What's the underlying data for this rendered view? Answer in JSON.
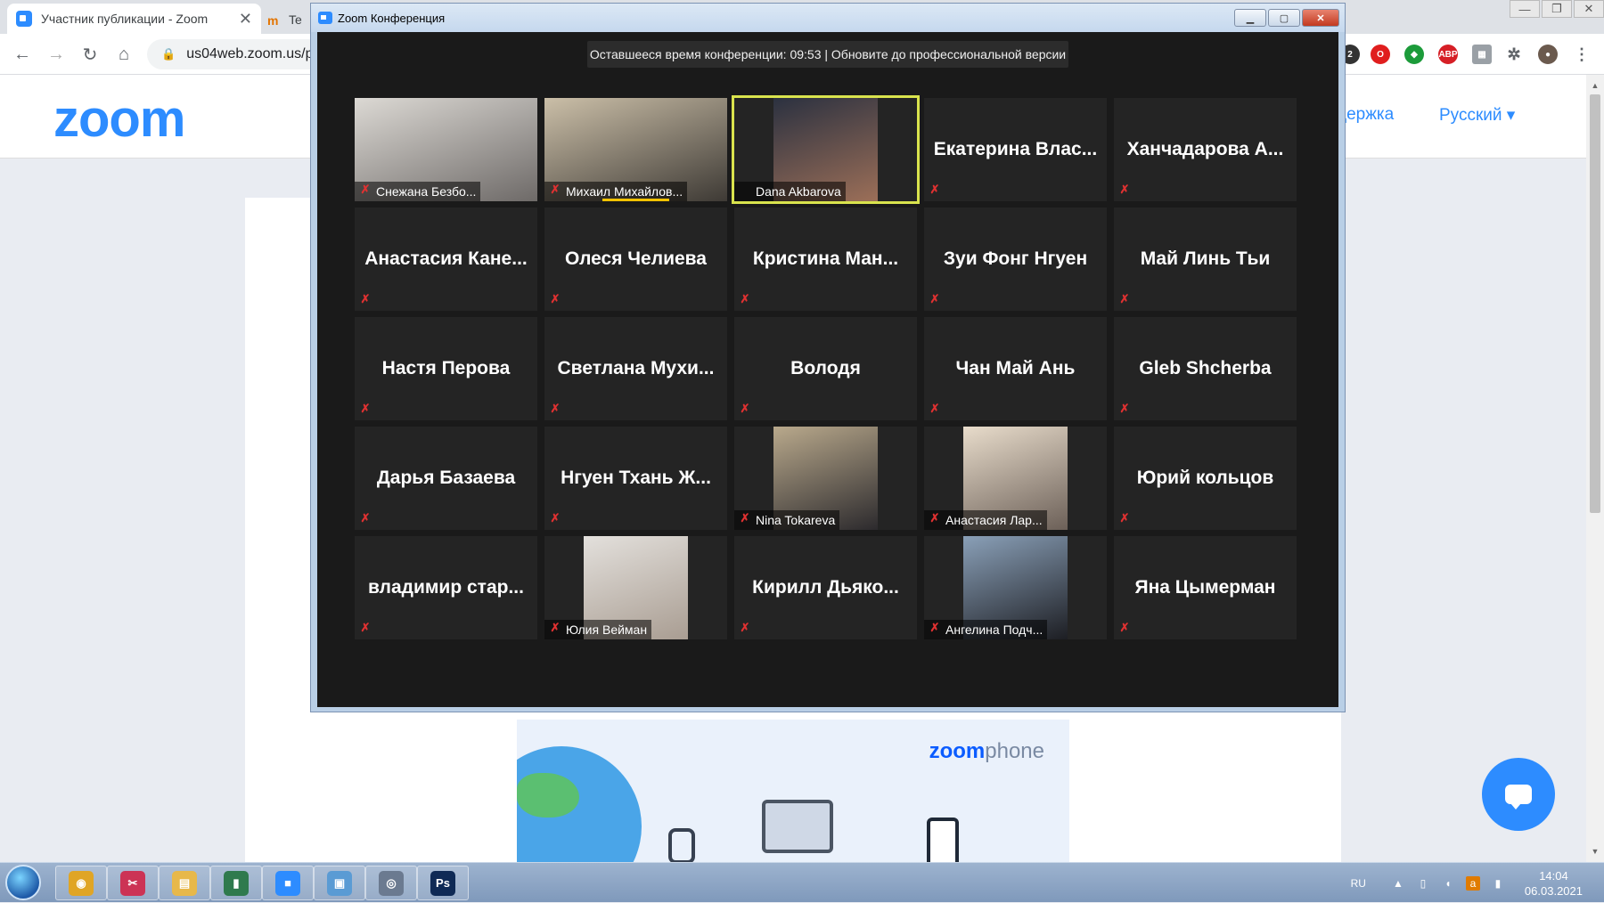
{
  "browser": {
    "tab_title": "Участник публикации - Zoom",
    "tab_close": "✕",
    "second_tab": "Te",
    "url": "us04web.zoom.us/p"
  },
  "site": {
    "logo": "zoom",
    "support": "держка",
    "language": "Русский ▾"
  },
  "banner": {
    "logo_bold": "zoom",
    "logo_light": "phone"
  },
  "zoom_window": {
    "title": "Zoom Конференция",
    "timer": "Оставшееся время конференции: 09:53 | Обновите до профессиональной версии",
    "participants": [
      {
        "label": "Снежана Безбо...",
        "video": "full",
        "c1": "#dcd9d4",
        "c2": "#6e6a68"
      },
      {
        "label": "Михаил Михайлов...",
        "video": "full",
        "c1": "#cbbfa8",
        "c2": "#3e3a35",
        "speaking": true
      },
      {
        "label": "Dana Akbarova",
        "video": "center",
        "c1": "#2b3140",
        "c2": "#9c6f58",
        "active": true
      },
      {
        "name": "Екатерина  Влас..."
      },
      {
        "name": "Ханчадарова  А..."
      },
      {
        "name": "Анастасия  Кане..."
      },
      {
        "name": "Олеся Челиева"
      },
      {
        "name": "Кристина  Ман..."
      },
      {
        "name": "Зуи Фонг Нгуен"
      },
      {
        "name": "Май Линь Тьи"
      },
      {
        "name": "Настя Перова"
      },
      {
        "name": "Светлана  Мухи..."
      },
      {
        "name": "Володя"
      },
      {
        "name": "Чан Май Ань"
      },
      {
        "name": "Gleb Shcherba"
      },
      {
        "name": "Дарья Базаева"
      },
      {
        "name": "Нгуен Тхань Ж..."
      },
      {
        "label": "Nina Tokareva",
        "video": "center",
        "c1": "#b9a98c",
        "c2": "#2c2a2d"
      },
      {
        "label": "Анастасия Лар...",
        "video": "center",
        "c1": "#e8dccb",
        "c2": "#6c6058"
      },
      {
        "name": "Юрий кольцов"
      },
      {
        "name": "владимир стар..."
      },
      {
        "label": "Юлия Вейман",
        "video": "center",
        "c1": "#e3e0dc",
        "c2": "#a99d92"
      },
      {
        "name": "Кирилл Дьяко..."
      },
      {
        "label": "Ангелина Подч...",
        "video": "center",
        "c1": "#8aa0b8",
        "c2": "#1d1e23"
      },
      {
        "name": "Яна Цымерман"
      }
    ]
  },
  "taskbar": {
    "lang": "RU",
    "time": "14:04",
    "date": "06.03.2021",
    "apps": [
      {
        "name": "chrome",
        "color": "#e0a525",
        "glyph": "◉"
      },
      {
        "name": "tool",
        "color": "#cc3355",
        "glyph": "✂"
      },
      {
        "name": "explorer",
        "color": "#e7b84a",
        "glyph": "▤"
      },
      {
        "name": "app",
        "color": "#2f7a4d",
        "glyph": "▮"
      },
      {
        "name": "zoom",
        "color": "#2d8cff",
        "glyph": "■"
      },
      {
        "name": "remote",
        "color": "#5a9bd4",
        "glyph": "▣"
      },
      {
        "name": "search",
        "color": "#6b7a90",
        "glyph": "◎"
      },
      {
        "name": "photoshop",
        "color": "#0f2a55",
        "glyph": "Ps"
      }
    ]
  },
  "colors": {
    "zoom_blue": "#2d8cff",
    "active_speaker": "#d9e34d",
    "muted_icon": "#e03131",
    "zoom_bg": "#1a1a1a"
  }
}
